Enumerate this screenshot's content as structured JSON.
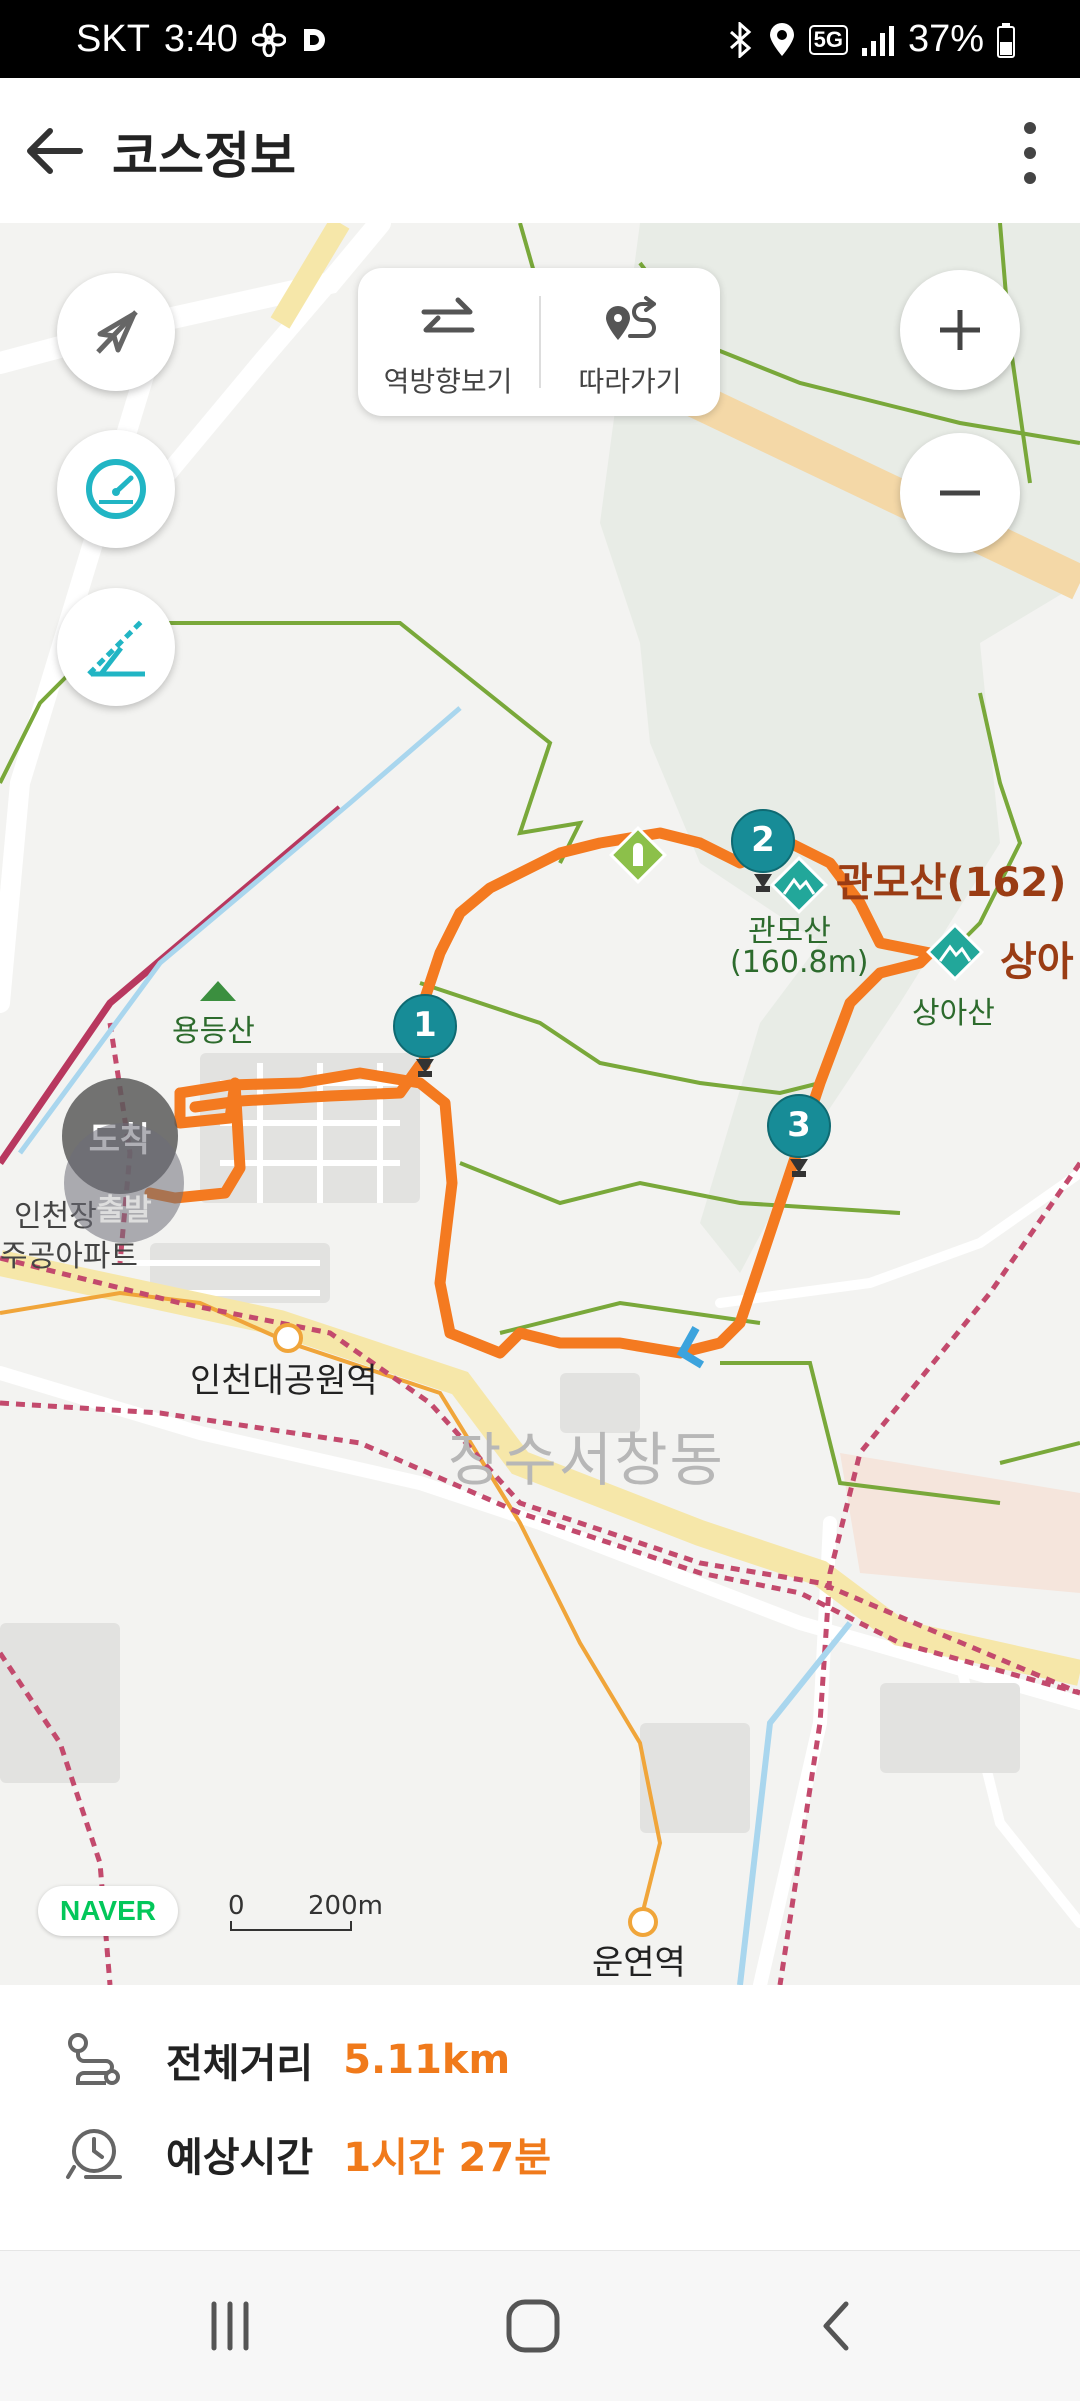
{
  "status_bar": {
    "carrier": "SKT",
    "time": "3:40",
    "network": "5G",
    "battery": "37%"
  },
  "app_bar": {
    "title": "코스정보"
  },
  "map": {
    "reverse_button_label": "역방향보기",
    "follow_button_label": "따라가기",
    "arrival_label": "도착",
    "departure_label": "출발",
    "scale_zero": "0",
    "scale_distance": "200m",
    "provider_logo": "NAVER",
    "places": {
      "yongdeungsan": "용등산",
      "incheon_apt_1": "인천장",
      "incheon_apt_2": "주공아파트",
      "incheon_grand_park_station": "인천대공원역",
      "jangsu_seochang_dong": "장수서창동",
      "gwanmosan_162": "관모산(162)",
      "gwanmosan_name": "관모산",
      "gwanmosan_height": "(160.8m)",
      "sanga": "상아",
      "sangasan": "상아산",
      "unyeon_station": "운연역"
    },
    "waypoints": [
      "1",
      "2",
      "3"
    ],
    "colors": {
      "route": "#f47a20",
      "trail": "#79a83a",
      "pin": "#178c97",
      "peak": "#22a79a"
    }
  },
  "course_info": {
    "distance_label": "전체거리",
    "distance_value": "5.11km",
    "time_label": "예상시간",
    "time_value": "1시간 27분"
  }
}
